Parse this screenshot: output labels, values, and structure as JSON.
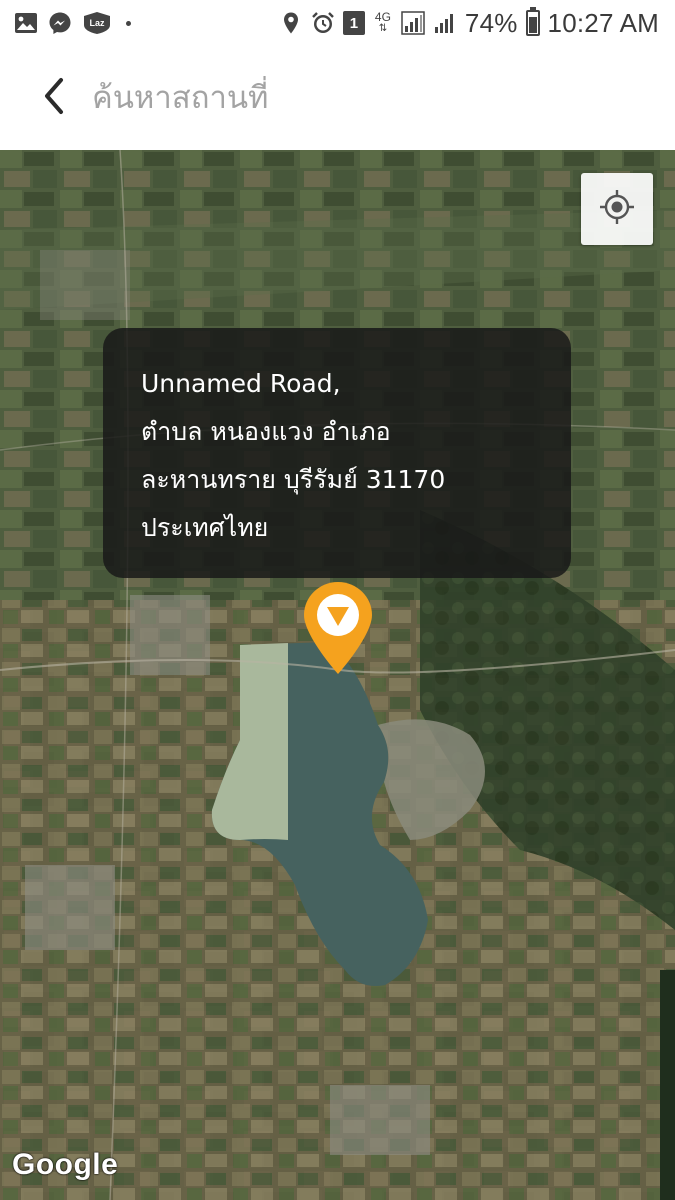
{
  "status_bar": {
    "battery_percent": "74%",
    "time": "10:27 AM",
    "network_type": "4G",
    "sim_slot": "1",
    "app_badge": "Laz",
    "battery_level": 0.74,
    "left_icons": [
      "image-icon",
      "messenger-icon",
      "lazada-icon",
      "dot-icon"
    ],
    "right_icons": [
      "location-icon",
      "alarm-icon",
      "sim-icon",
      "network-4g-icon",
      "signal-1-icon",
      "signal-2-icon",
      "battery-icon"
    ]
  },
  "app_bar": {
    "back_icon": "chevron-left-icon",
    "search_placeholder": "ค้นหาสถานที่",
    "search_value": ""
  },
  "map": {
    "info_window": {
      "lines": [
        "Unnamed Road,",
        "ตำบล หนองแวง อำเภอ",
        "ละหานทราย บุรีรัมย์ 31170",
        "ประเทศไทย"
      ]
    },
    "pin_icon": "map-pin-icon",
    "pin_color": "#F5A21E",
    "locate_icon": "my-location-icon",
    "attribution": "Google"
  },
  "colors": {
    "accent": "#F5A21E",
    "placeholder": "#A3A3A3",
    "bubble_bg": "#181818"
  }
}
